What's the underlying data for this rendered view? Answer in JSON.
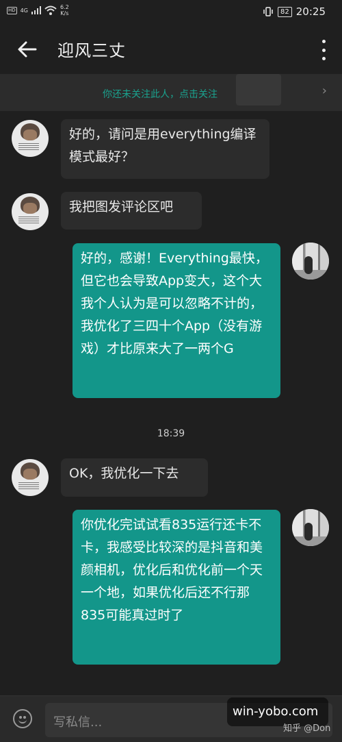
{
  "status_bar": {
    "hd": "HD",
    "net": "4G",
    "speed_value": "6.2",
    "speed_unit": "K/s",
    "battery": "82",
    "time": "20:25"
  },
  "app_bar": {
    "title": "迎风三丈",
    "back_icon": "arrow-left-icon",
    "more_icon": "more-vertical-icon"
  },
  "follow_banner": {
    "text": "你还未关注此人，点击关注",
    "chevron": "›"
  },
  "messages": [
    {
      "side": "in",
      "text": "好的，请问是用everything编译模式最好？"
    },
    {
      "side": "in",
      "text": "我把图发评论区吧"
    },
    {
      "side": "out",
      "text": "好的，感谢！Everything最快，但它也会导致App变大，这个大我个人认为是可以忽略不计的，我优化了三四十个App（没有游戏）才比原来大了一两个G"
    },
    {
      "side": "time",
      "text": "18:39"
    },
    {
      "side": "in",
      "text": "OK，我优化一下去"
    },
    {
      "side": "out",
      "text": "你优化完试试看835运行还卡不卡，我感受比较深的是抖音和美颜相机，优化后和优化前一个天一个地，如果优化后还不行那835可能真过时了"
    }
  ],
  "composer": {
    "placeholder": "写私信...",
    "emoji_icon": "emoji-icon"
  },
  "watermark": {
    "site": "win-yobo.com",
    "credit": "知乎 @Don"
  }
}
